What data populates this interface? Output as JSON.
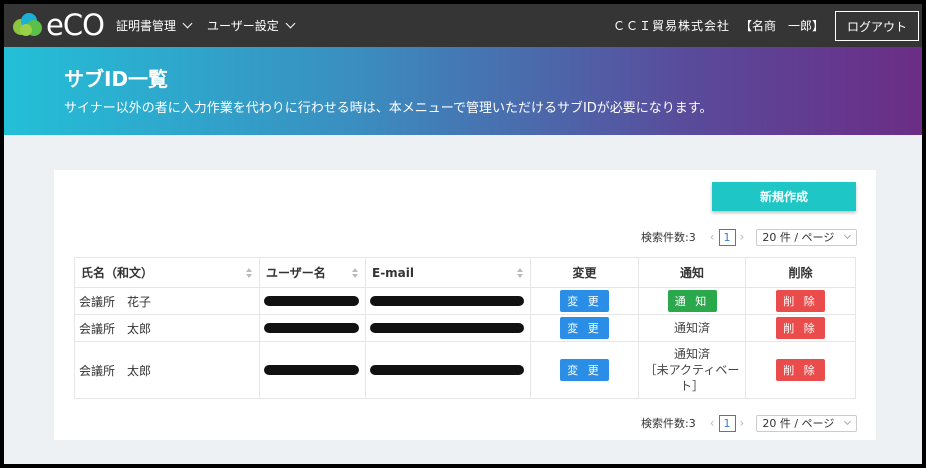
{
  "header": {
    "logo_text": "eCO",
    "nav": [
      {
        "label": "証明書管理"
      },
      {
        "label": "ユーザー設定"
      }
    ],
    "company": "ＣＣＩ貿易株式会社",
    "user": "【名商　一郎】",
    "logout_label": "ログアウト"
  },
  "banner": {
    "title": "サブID一覧",
    "description": "サイナー以外の者に入力作業を代わりに行わせる時は、本メニューで管理いただけるサブIDが必要になります。"
  },
  "actions": {
    "new_label": "新規作成"
  },
  "pager_top": {
    "count_label": "検索件数:3",
    "page": "1",
    "page_size": "20 件 / ページ"
  },
  "pager_bottom": {
    "count_label": "検索件数:3",
    "page": "1",
    "page_size": "20 件 / ページ"
  },
  "table": {
    "headers": [
      "氏名（和文）",
      "ユーザー名",
      "E-mail",
      "変更",
      "通知",
      "削除"
    ],
    "rows": [
      {
        "name": "会議所　花子",
        "change": "変 更",
        "notify_button": "通 知",
        "notify_status": "",
        "delete": "削 除"
      },
      {
        "name": "会議所　太郎",
        "change": "変 更",
        "notify_status": "通知済",
        "delete": "削 除"
      },
      {
        "name": "会議所　太郎",
        "change": "変 更",
        "notify_status": "通知済",
        "notify_status_2": "［未アクティベー",
        "notify_status_3": "ト］",
        "delete": "削 除"
      }
    ]
  },
  "colors": {
    "topbar": "#353535",
    "accent_teal": "#1ec6c6",
    "button_blue": "#2b8ee6",
    "button_green": "#2ca84c",
    "button_red": "#ea4b4b"
  }
}
